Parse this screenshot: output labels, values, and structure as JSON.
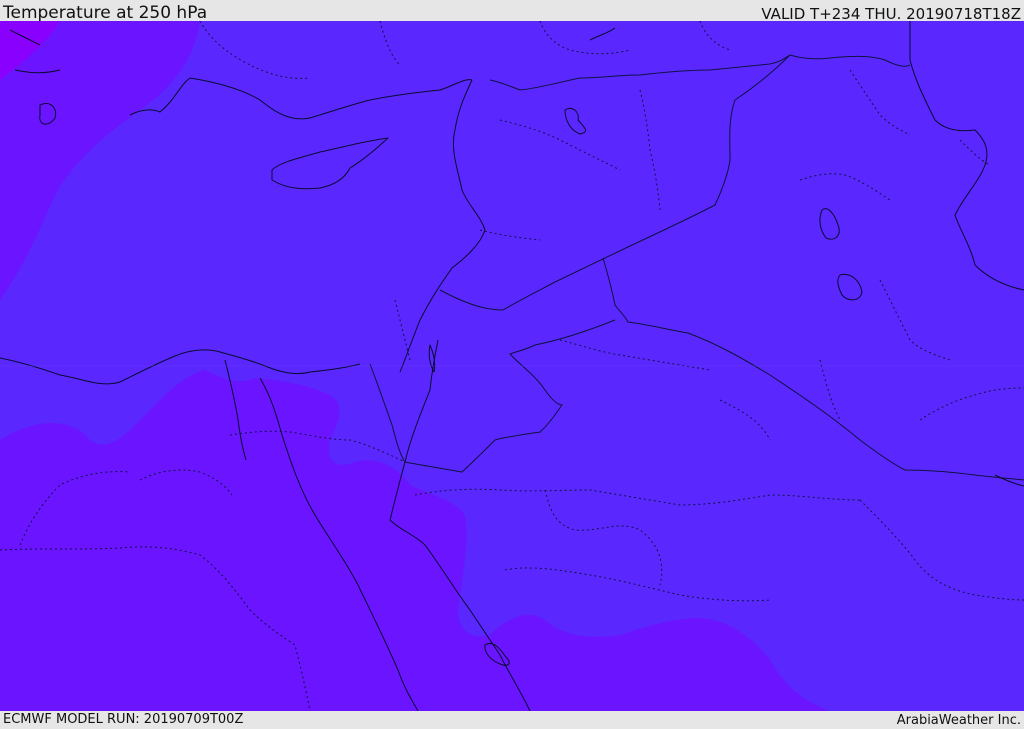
{
  "header": {
    "title": "Temperature at 250 hPa",
    "valid_time": "VALID T+234 THU. 20190718T18Z"
  },
  "footer": {
    "model_run": "ECMWF MODEL RUN: 20190709T00Z",
    "credit": "ArabiaWeather Inc."
  },
  "colors": {
    "field_main": "#5a28ff",
    "field_cold": "#6b14ff",
    "field_coldest": "#8a00ff",
    "coastline": "#0a0a30",
    "border": "#101040",
    "frame": "#e6e6e6"
  }
}
